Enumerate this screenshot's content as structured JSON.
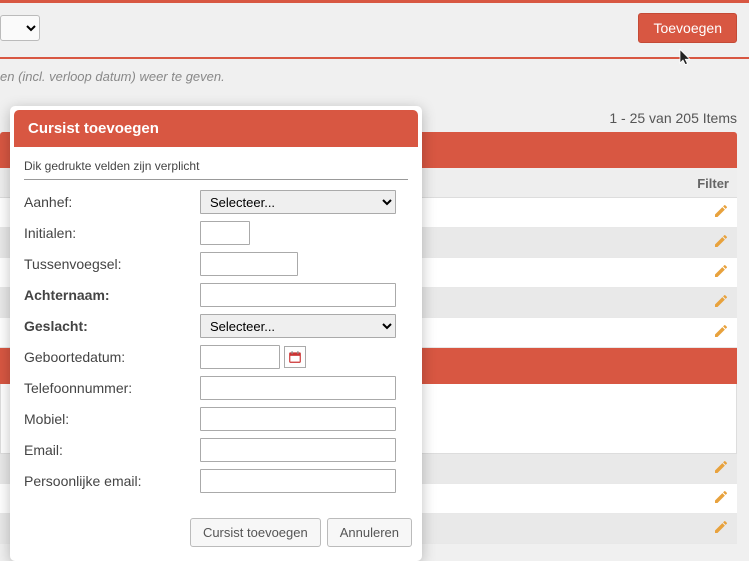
{
  "toolbar": {
    "toevoegen_label": "Toevoegen"
  },
  "instruction_text": "en (incl. verloop datum) weer te geven.",
  "pagination": "1 - 25 van 205 Items",
  "table": {
    "filter_label": "Filter"
  },
  "dialog": {
    "title": "Cursist toevoegen",
    "note": "Dik gedrukte velden zijn verplicht",
    "fields": {
      "aanhef": {
        "label": "Aanhef:",
        "placeholder": "Selecteer..."
      },
      "initialen": {
        "label": "Initialen:"
      },
      "tussenvoegsel": {
        "label": "Tussenvoegsel:"
      },
      "achternaam": {
        "label": "Achternaam:"
      },
      "geslacht": {
        "label": "Geslacht:",
        "placeholder": "Selecteer..."
      },
      "geboortedatum": {
        "label": "Geboortedatum:"
      },
      "telefoon": {
        "label": "Telefoonnummer:"
      },
      "mobiel": {
        "label": "Mobiel:"
      },
      "email": {
        "label": "Email:"
      },
      "persoonlijke_email": {
        "label": "Persoonlijke email:"
      }
    },
    "buttons": {
      "submit": "Cursist toevoegen",
      "cancel": "Annuleren"
    }
  },
  "colors": {
    "accent": "#d85742"
  }
}
